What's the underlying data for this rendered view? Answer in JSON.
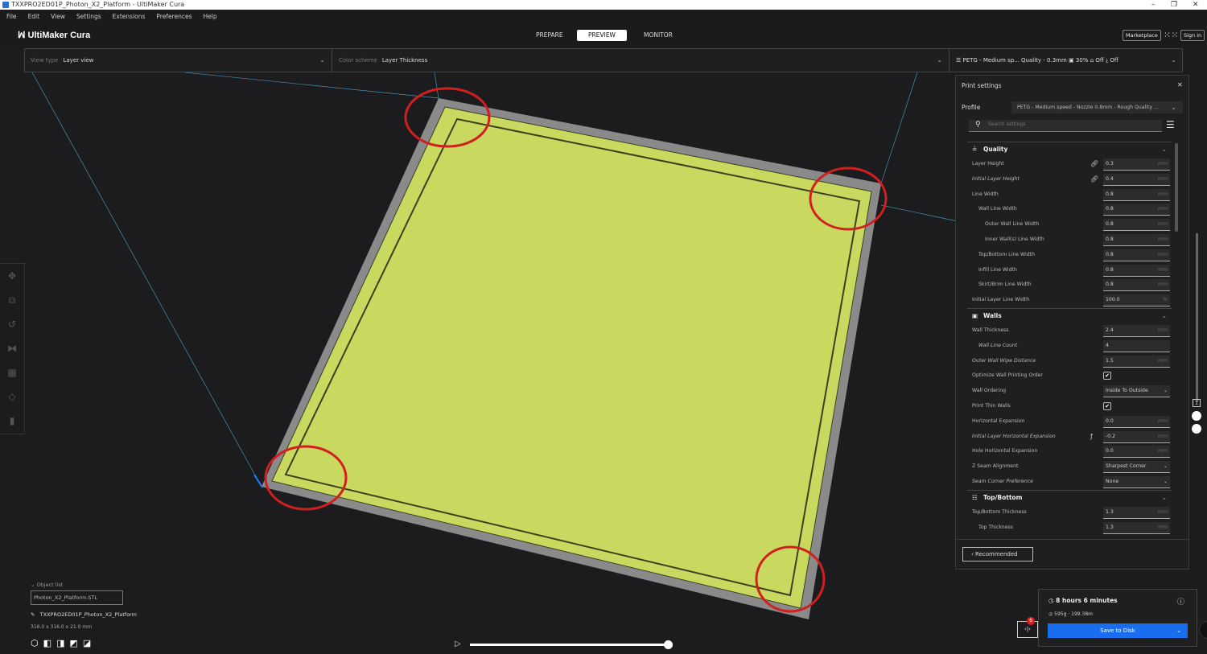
{
  "window": {
    "title": "TXXPRO2ED01P_Photon_X2_Platform - UltiMaker Cura",
    "minimize": "–",
    "restore": "❐",
    "close": "✕"
  },
  "menu": [
    "File",
    "Edit",
    "View",
    "Settings",
    "Extensions",
    "Preferences",
    "Help"
  ],
  "header": {
    "logo": "UltiMaker Cura",
    "stages": [
      "PREPARE",
      "PREVIEW",
      "MONITOR"
    ],
    "marketplace": "Marketplace",
    "sign_in": "Sign in"
  },
  "toolbar": {
    "view_type_label": "View type",
    "view_type": "Layer view",
    "color_scheme_label": "Color scheme",
    "color_scheme": "Layer Thickness",
    "profile_summary": "PETG - Medium sp... Quality - 0.3mm",
    "infill": "30%",
    "support": "Off",
    "adhesion": "Off"
  },
  "print_settings": {
    "title": "Print settings",
    "close": "✕",
    "profile_label": "Profile",
    "profile": "PETG - Medium speed - Nozzle 0.8mm - Rough Quality ...",
    "search_placeholder": "Search settings",
    "recommended": "Recommended",
    "categories": [
      {
        "name": "Quality",
        "icon": "quality-icon",
        "rows": [
          {
            "label": "Layer Height",
            "value": "0.3",
            "unit": "mm",
            "icon": "link"
          },
          {
            "label": "Initial Layer Height",
            "value": "0.4",
            "unit": "mm",
            "icon": "link",
            "italic": true
          },
          {
            "label": "Line Width",
            "value": "0.8",
            "unit": "mm"
          },
          {
            "label": "Wall Line Width",
            "value": "0.8",
            "unit": "mm",
            "indent": 1
          },
          {
            "label": "Outer Wall Line Width",
            "value": "0.8",
            "unit": "mm",
            "indent": 2
          },
          {
            "label": "Inner Wall(s) Line Width",
            "value": "0.8",
            "unit": "mm",
            "indent": 2
          },
          {
            "label": "Top/Bottom Line Width",
            "value": "0.8",
            "unit": "mm",
            "indent": 1
          },
          {
            "label": "Infill Line Width",
            "value": "0.8",
            "unit": "mm",
            "indent": 1
          },
          {
            "label": "Skirt/Brim Line Width",
            "value": "0.8",
            "unit": "mm",
            "indent": 1
          },
          {
            "label": "Initial Layer Line Width",
            "value": "100.0",
            "unit": "%"
          }
        ]
      },
      {
        "name": "Walls",
        "icon": "walls-icon",
        "rows": [
          {
            "label": "Wall Thickness",
            "value": "2.4",
            "unit": "mm"
          },
          {
            "label": "Wall Line Count",
            "value": "4",
            "unit": "",
            "indent": 1,
            "italic": true
          },
          {
            "label": "Outer Wall Wipe Distance",
            "value": "1.5",
            "unit": "mm",
            "italic": true
          },
          {
            "label": "Optimize Wall Printing Order",
            "check": true
          },
          {
            "label": "Wall Ordering",
            "value": "Inside To Outside",
            "select": true
          },
          {
            "label": "Print Thin Walls",
            "check": true
          },
          {
            "label": "Horizontal Expansion",
            "value": "0.0",
            "unit": "mm"
          },
          {
            "label": "Initial Layer Horizontal Expansion",
            "value": "-0.2",
            "unit": "mm",
            "icon": "fx",
            "italic": true
          },
          {
            "label": "Hole Horizontal Expansion",
            "value": "0.0",
            "unit": "mm"
          },
          {
            "label": "Z Seam Alignment",
            "value": "Sharpest Corner",
            "select": true
          },
          {
            "label": "Seam Corner Preference",
            "value": "None",
            "select": true,
            "italic": true
          }
        ]
      },
      {
        "name": "Top/Bottom",
        "icon": "top-bottom-icon",
        "rows": [
          {
            "label": "Top/Bottom Thickness",
            "value": "1.3",
            "unit": "mm"
          },
          {
            "label": "Top Thickness",
            "value": "1.3",
            "unit": "mm",
            "indent": 1
          }
        ]
      }
    ]
  },
  "object_list": {
    "label": "Object list",
    "file": "Photon_X2_Platform.STL",
    "object_name": "TXXPRO2ED01P_Photon_X2_Platform",
    "dimensions": "316.0 x 316.0 x 21.0 mm"
  },
  "layer_slider": {
    "current_layer": "1"
  },
  "summary": {
    "time": "8 hours 6 minutes",
    "material": "595g · 199.38m",
    "save": "Save to Disk",
    "badge": "6"
  },
  "colors": {
    "accent": "#196ef0",
    "layer": "#c9d85e",
    "highlight": "#d11f1f"
  }
}
